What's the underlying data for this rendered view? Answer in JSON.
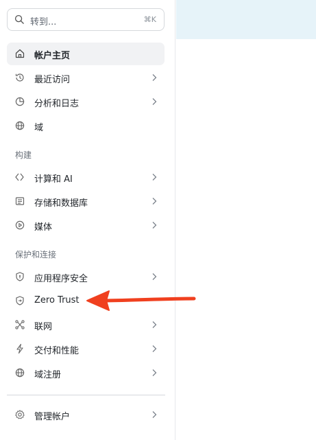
{
  "search": {
    "placeholder": "转到...",
    "shortcut": "⌘K"
  },
  "nav": {
    "home": "帐户主页",
    "recent": "最近访问",
    "analytics": "分析和日志",
    "domains": "域"
  },
  "sections": {
    "build": {
      "title": "构建",
      "items": [
        "计算和 AI",
        "存储和数据库",
        "媒体"
      ]
    },
    "protect": {
      "title": "保护和连接",
      "items": [
        "应用程序安全",
        "Zero Trust",
        "联网",
        "交付和性能",
        "域注册"
      ]
    }
  },
  "footer": {
    "manage": "管理帐户"
  },
  "colors": {
    "arrow": "#f0401f",
    "banner": "#e6f3f9",
    "active_bg": "#f1f2f4"
  }
}
